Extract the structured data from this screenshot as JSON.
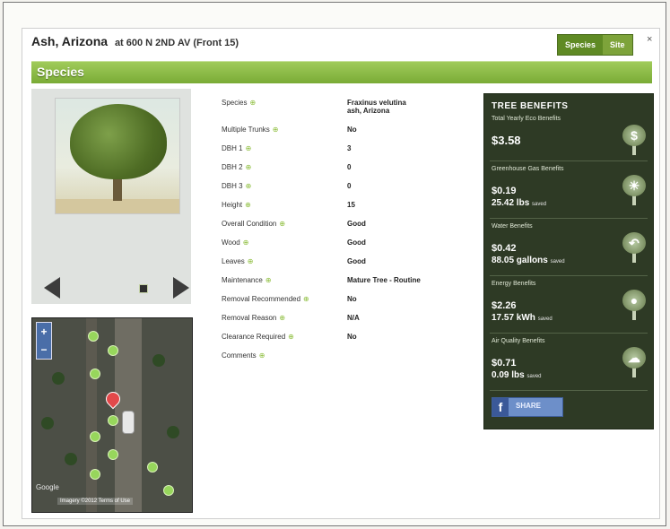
{
  "header": {
    "title": "Ash, Arizona",
    "subtitle": "at 600 N 2ND AV (Front 15)",
    "tabs": [
      "Species",
      "Site"
    ],
    "close": "×"
  },
  "section": {
    "title": "Species"
  },
  "attributes": [
    {
      "label": "Species",
      "value": "Fraxinus velutina",
      "value2": "ash, Arizona"
    },
    {
      "label": "Multiple Trunks",
      "value": "No"
    },
    {
      "label": "DBH 1",
      "value": "3"
    },
    {
      "label": "DBH 2",
      "value": "0"
    },
    {
      "label": "DBH 3",
      "value": "0"
    },
    {
      "label": "Height",
      "value": "15"
    },
    {
      "label": "Overall Condition",
      "value": "Good"
    },
    {
      "label": "Wood",
      "value": "Good"
    },
    {
      "label": "Leaves",
      "value": "Good"
    },
    {
      "label": "Maintenance",
      "value": "Mature Tree - Routine"
    },
    {
      "label": "Removal Recommended",
      "value": "No"
    },
    {
      "label": "Removal Reason",
      "value": "N/A"
    },
    {
      "label": "Clearance Required",
      "value": "No"
    },
    {
      "label": "Comments",
      "value": ""
    }
  ],
  "benefits": {
    "title": "TREE BENEFITS",
    "items": [
      {
        "label": "Total Yearly Eco Benefits",
        "amount": "$3.58",
        "quantity": "",
        "unit": "",
        "icon": "dollar-icon",
        "glyph": "$"
      },
      {
        "label": "Greenhouse Gas Benefits",
        "amount": "$0.19",
        "quantity": "25.42 lbs",
        "unit": "saved",
        "icon": "sun-icon",
        "glyph": "☀"
      },
      {
        "label": "Water Benefits",
        "amount": "$0.42",
        "quantity": "88.05 gallons",
        "unit": "saved",
        "icon": "water-icon",
        "glyph": "↶"
      },
      {
        "label": "Energy Benefits",
        "amount": "$2.26",
        "quantity": "17.57 kWh",
        "unit": "saved",
        "icon": "lightbulb-icon",
        "glyph": "●"
      },
      {
        "label": "Air Quality Benefits",
        "amount": "$0.71",
        "quantity": "0.09 lbs",
        "unit": "saved",
        "icon": "cloud-icon",
        "glyph": "☁"
      }
    ],
    "share_label": "SHARE",
    "share_glyph": "f"
  },
  "map": {
    "zoom_in": "+",
    "zoom_out": "−",
    "brand": "Google",
    "credit": "Imagery ©2012 Terms of Use"
  }
}
